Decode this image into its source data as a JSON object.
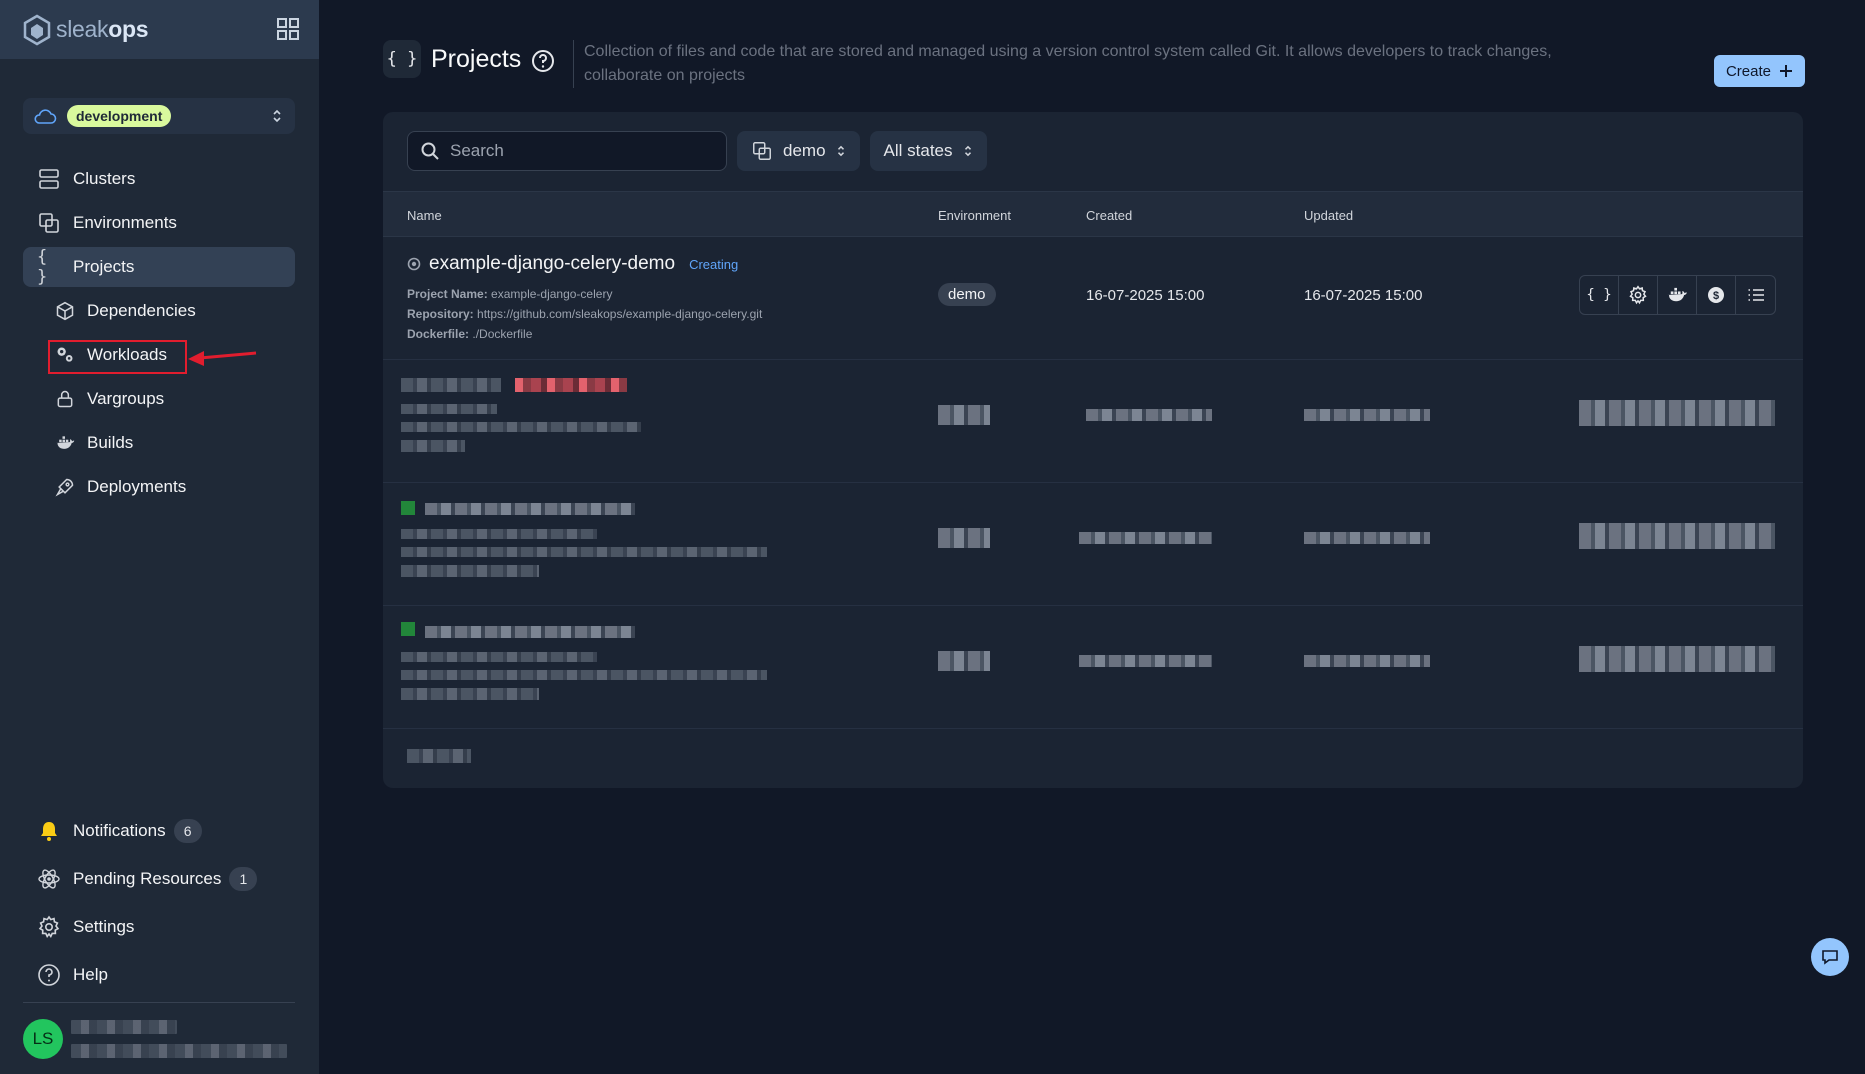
{
  "brand": {
    "name_light": "sleak",
    "name_bold": "ops"
  },
  "environment_selector": {
    "value": "development"
  },
  "nav": {
    "items": [
      {
        "label": "Clusters",
        "icon": "server-icon"
      },
      {
        "label": "Environments",
        "icon": "copy-icon"
      },
      {
        "label": "Projects",
        "icon": "braces-icon"
      },
      {
        "label": "Dependencies",
        "icon": "cube-icon"
      },
      {
        "label": "Workloads",
        "icon": "gears-icon"
      },
      {
        "label": "Vargroups",
        "icon": "lock-icon"
      },
      {
        "label": "Builds",
        "icon": "docker-icon"
      },
      {
        "label": "Deployments",
        "icon": "rocket-icon"
      }
    ],
    "active": "Projects",
    "highlighted": "Workloads"
  },
  "bottom_nav": {
    "notifications": {
      "label": "Notifications",
      "count": "6"
    },
    "pending": {
      "label": "Pending Resources",
      "count": "1"
    },
    "settings": {
      "label": "Settings"
    },
    "help": {
      "label": "Help"
    }
  },
  "user": {
    "initials": "LS"
  },
  "page": {
    "title": "Projects",
    "description": "Collection of files and code that are stored and managed using a version control system called Git. It allows developers to track changes, collaborate on projects",
    "create_label": "Create"
  },
  "filters": {
    "search_placeholder": "Search",
    "environment": "demo",
    "state": "All states"
  },
  "table": {
    "headers": {
      "name": "Name",
      "environment": "Environment",
      "created": "Created",
      "updated": "Updated"
    },
    "rows": [
      {
        "name": "example-django-celery-demo",
        "state": "Creating",
        "project_name_label": "Project Name:",
        "project_name": "example-django-celery",
        "repository_label": "Repository:",
        "repository": "https://github.com/sleakops/example-django-celery.git",
        "dockerfile_label": "Dockerfile:",
        "dockerfile": "./Dockerfile",
        "environment": "demo",
        "created": "16-07-2025 15:00",
        "updated": "16-07-2025 15:00"
      }
    ]
  },
  "colors": {
    "accent": "#93c5fd",
    "sidebar_bg": "#1f2937",
    "main_bg": "#111827",
    "env_badge": "#d9f99d",
    "highlight": "#e11d2e",
    "avatar": "#22c55e"
  }
}
